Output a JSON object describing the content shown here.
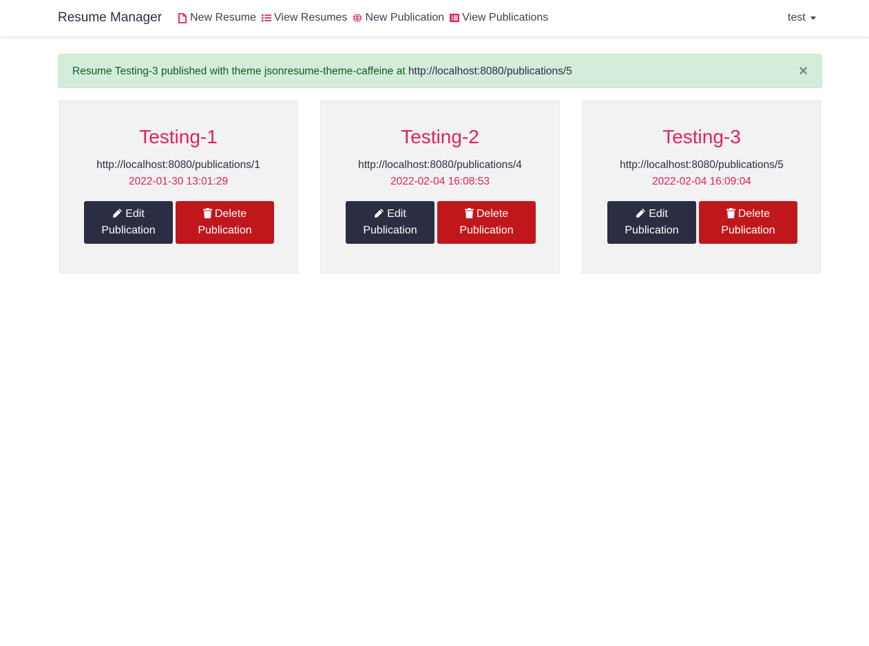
{
  "navbar": {
    "brand": "Resume Manager",
    "links": [
      {
        "label": "New Resume",
        "icon": "file-icon"
      },
      {
        "label": "View Resumes",
        "icon": "list-icon"
      },
      {
        "label": "New Publication",
        "icon": "globe-icon"
      },
      {
        "label": "View Publications",
        "icon": "list-alt-icon"
      }
    ],
    "user": "test"
  },
  "alert": {
    "message": "Resume Testing-3 published with theme jsonresume-theme-caffeine at ",
    "url": "http://localhost:8080/publications/5",
    "close": "×"
  },
  "publications": [
    {
      "title": "Testing-1",
      "url": "http://localhost:8080/publications/1",
      "date": "2022-01-30 13:01:29",
      "edit_label_1": "Edit",
      "edit_label_2": "Publication",
      "delete_label_1": "Delete",
      "delete_label_2": "Publication"
    },
    {
      "title": "Testing-2",
      "url": "http://localhost:8080/publications/4",
      "date": "2022-02-04 16:08:53",
      "edit_label_1": "Edit",
      "edit_label_2": "Publication",
      "delete_label_1": "Delete",
      "delete_label_2": "Publication"
    },
    {
      "title": "Testing-3",
      "url": "http://localhost:8080/publications/5",
      "date": "2022-02-04 16:09:04",
      "edit_label_1": "Edit",
      "edit_label_2": "Publication",
      "delete_label_1": "Delete",
      "delete_label_2": "Publication"
    }
  ],
  "colors": {
    "accent": "#e2205f",
    "primary": "#2b2d42",
    "danger": "#c0171d",
    "alert_bg": "#d4edda",
    "alert_text": "#155724",
    "card_bg": "#f2f2f2"
  }
}
